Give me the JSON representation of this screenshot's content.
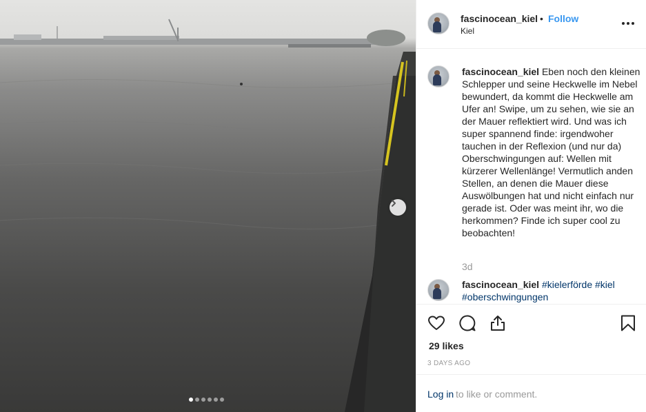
{
  "post": {
    "username": "fascinocean_kiel",
    "separator": "•",
    "follow_label": "Follow",
    "location": "Kiel",
    "caption_text": "Eben noch den kleinen Schlepper und seine Heckwelle im Nebel bewundert, da kommt die Heckwelle am Ufer an! Swipe, um zu sehen, wie sie an der Mauer reflektiert wird. Und was ich super spannend finde: irgendwoher tauchen in der Reflexion (und nur da) Oberschwingungen auf: Wellen mit kürzerer Wellenlänge! Vermutlich anden Stellen, an denen die Mauer diese Auswölbungen hat und nicht einfach nur gerade ist. Oder was meint ihr, wo die herkommen? Finde ich super cool zu beobachten!",
    "caption_time": "3d",
    "hashtags": [
      "#kielerförde",
      "#kiel",
      "#oberschwingungen"
    ],
    "likes": "29 likes",
    "posted_ago": "3 DAYS AGO",
    "login_link": "Log in",
    "login_rest": "to like or comment."
  },
  "carousel": {
    "slide_count": 6,
    "active_index": 0
  },
  "icons": {
    "more": "more-options-icon",
    "next": "chevron-right-icon",
    "like": "heart-icon",
    "comment": "comment-icon",
    "share": "share-icon",
    "save": "bookmark-icon"
  },
  "colors": {
    "link_blue": "#3897f0",
    "hashtag_blue": "#003569",
    "muted": "#999999",
    "text": "#262626"
  }
}
